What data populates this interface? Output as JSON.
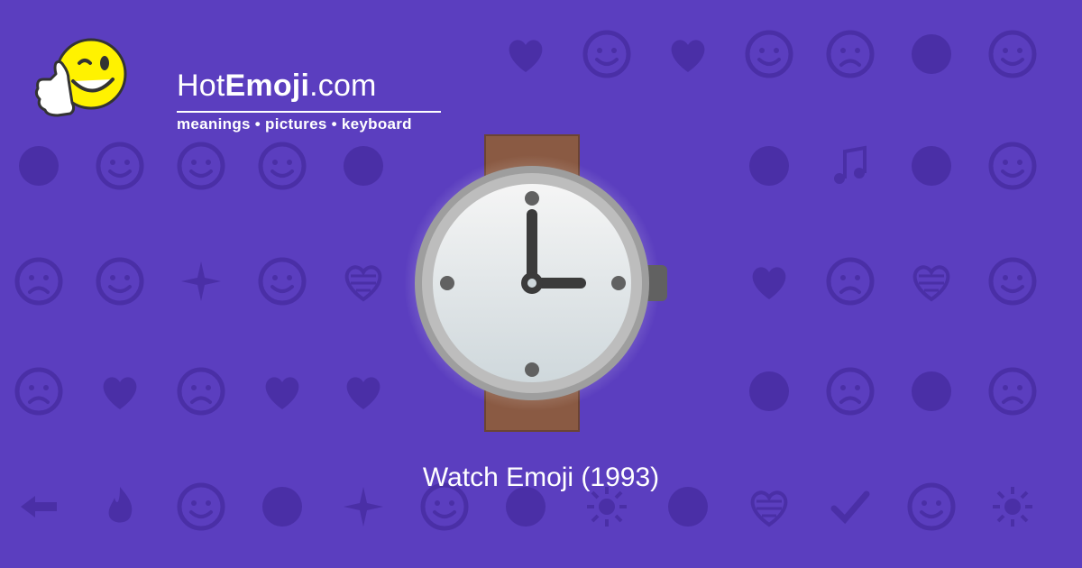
{
  "site": {
    "name_light_prefix": "Hot",
    "name_bold": "Emoji",
    "name_light_suffix": ".com",
    "tagline": "meanings • pictures • keyboard"
  },
  "emoji": {
    "caption": "Watch Emoji (1993)",
    "icon": "watch-icon"
  },
  "colors": {
    "background": "#5b3ebf",
    "pattern": "#4a2fa6",
    "strap": "#8a5a43",
    "bezel": "#9e9e9e",
    "face": "#eceff1",
    "hands": "#3b3b3b",
    "text": "#ffffff",
    "mascot_face": "#fff200"
  },
  "background_icons": [
    "heart-icon",
    "kiss-face-icon",
    "two-hearts-icon",
    "smiley-icon",
    "weary-face-icon",
    "ok-hand-icon",
    "neutral-face-icon",
    "eyes-icon",
    "smirk-face-icon",
    "relieved-face-icon",
    "shaking-face-icon",
    "recycle-icon",
    "raising-hands-icon",
    "music-notes-icon",
    "see-no-evil-icon",
    "sleeping-face-icon",
    "frowning-face-icon",
    "grinning-face-icon",
    "sparkles-icon",
    "grin-face-icon",
    "striped-heart-icon",
    "broken-heart-icon",
    "confused-face-icon",
    "striped-heart-icon",
    "tongue-wink-icon",
    "sad-face-icon",
    "heart-arrow-icon",
    "tired-face-icon",
    "revolving-hearts-icon",
    "heart-outline-icon",
    "monkey-icon",
    "scream-face-icon",
    "devil-face-icon",
    "angry-face-icon",
    "left-arrow-icon",
    "fire-icon",
    "grin-face-icon",
    "fist-icon",
    "party-popper-icon",
    "tongue-wink-icon",
    "rose-icon",
    "sun-icon",
    "flexed-biceps-icon",
    "striped-heart-icon",
    "check-mark-icon",
    "squinting-face-icon",
    "sunglasses-face-icon",
    "heart-eyes-cat-icon",
    "waving-hand-icon",
    "grimacing-face-icon",
    "camera-icon",
    "worried-face-icon",
    "striped-heart-icon",
    "beaming-face-icon",
    "beating-heart-icon",
    "kiss-face-icon"
  ]
}
